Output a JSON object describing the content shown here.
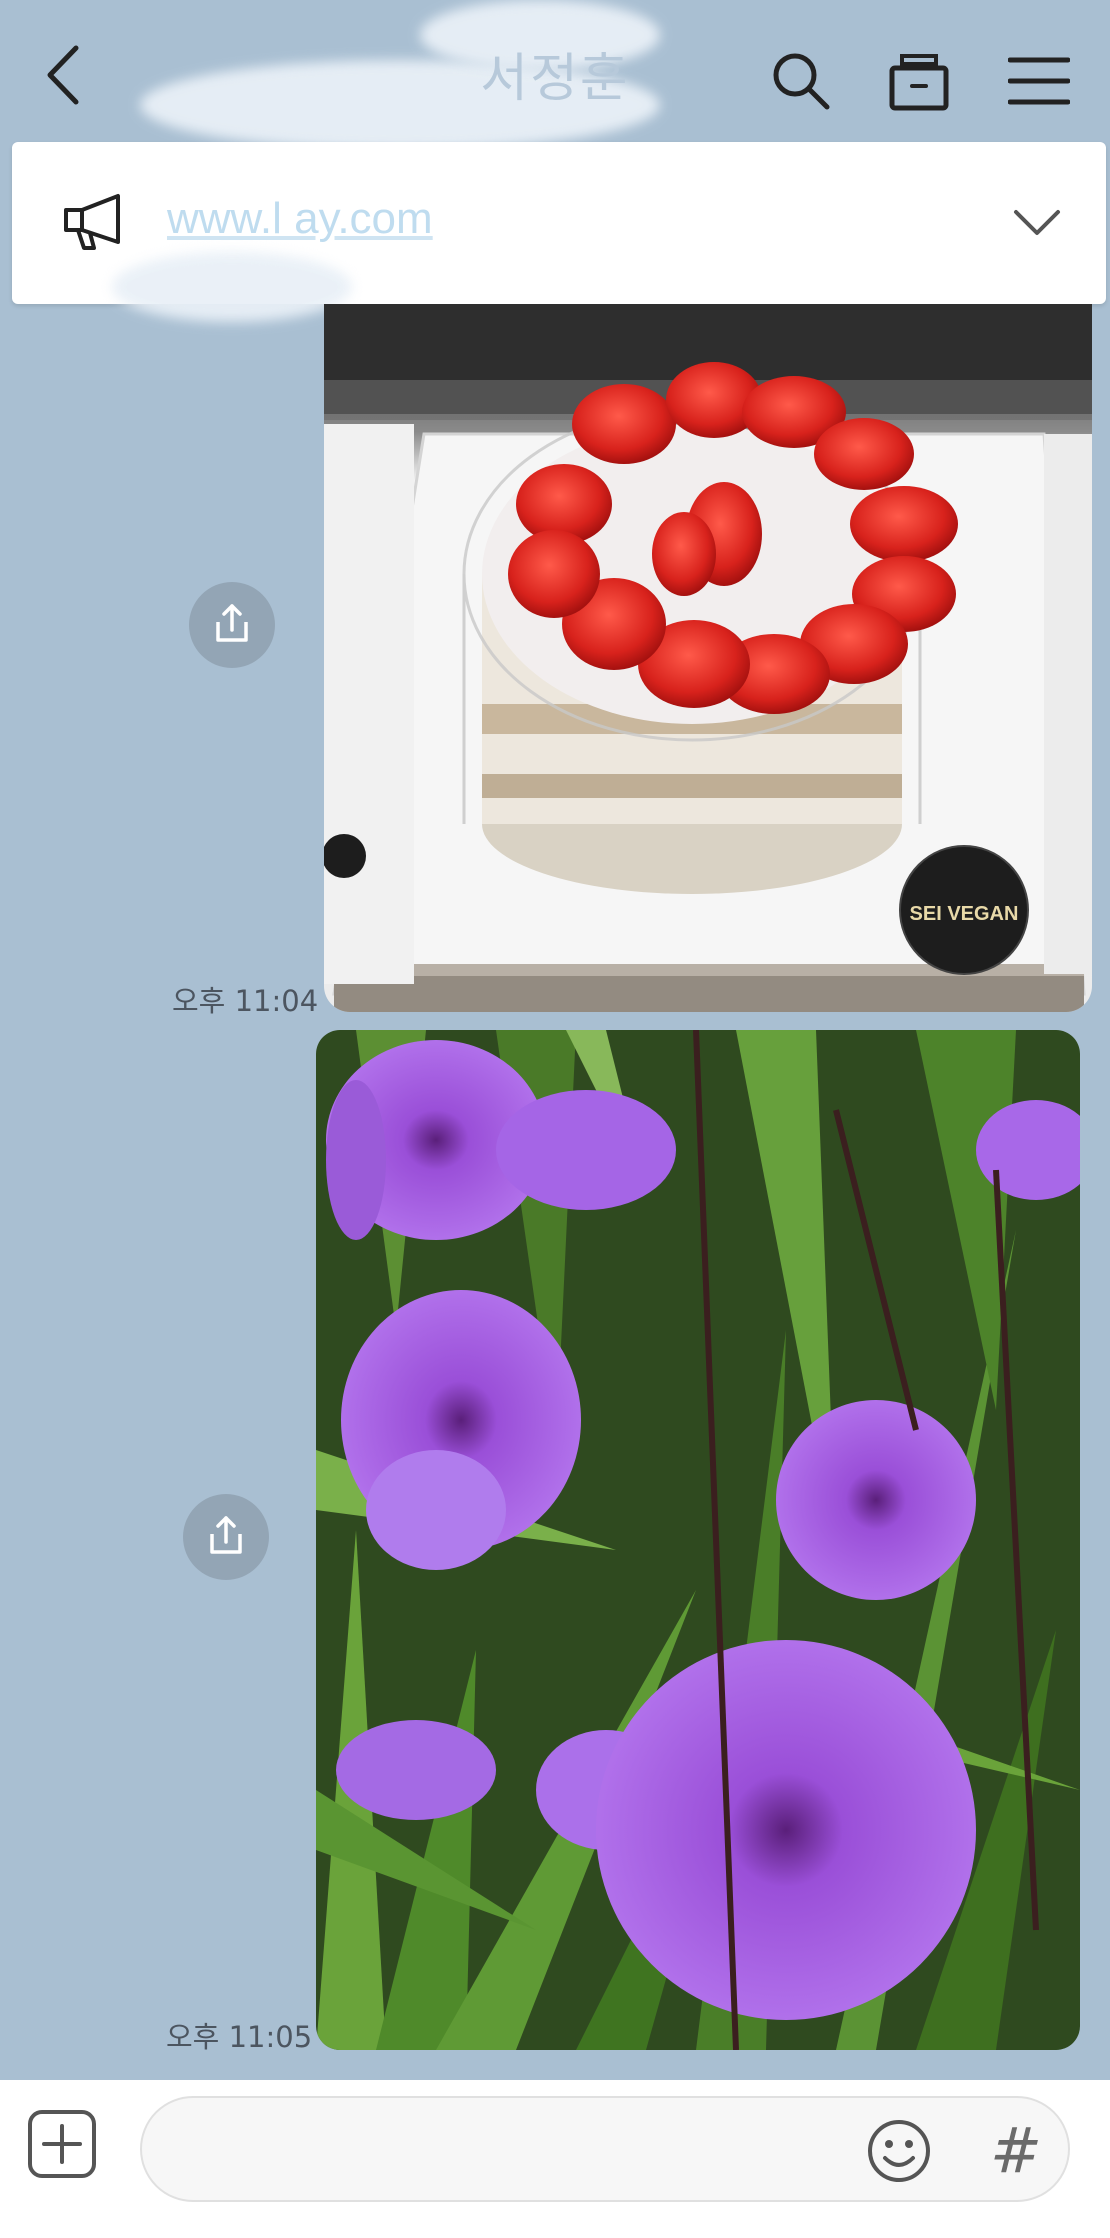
{
  "header": {
    "title": "서정훈",
    "back_icon": "chevron-left-icon",
    "search_icon": "search-icon",
    "archive_icon": "archive-box-icon",
    "menu_icon": "hamburger-menu-icon"
  },
  "notice": {
    "icon": "megaphone-icon",
    "text": "www.l       ay.com",
    "expand_icon": "chevron-down-icon"
  },
  "messages": [
    {
      "type": "image",
      "subject": "strawberry cake",
      "time": "오후 11:04",
      "share_icon": "share-upload-icon"
    },
    {
      "type": "image",
      "subject": "purple flowers",
      "time": "오후 11:05",
      "share_icon": "share-upload-icon"
    }
  ],
  "cake_sticker": {
    "brand": "SEI VEGAN"
  },
  "composer": {
    "add_icon": "plus-square-icon",
    "placeholder": "",
    "emoji_icon": "emoji-smile-icon",
    "hashtag_label": "#"
  },
  "colors": {
    "background": "#a9bfd2",
    "share_button": "#93a5b5"
  }
}
